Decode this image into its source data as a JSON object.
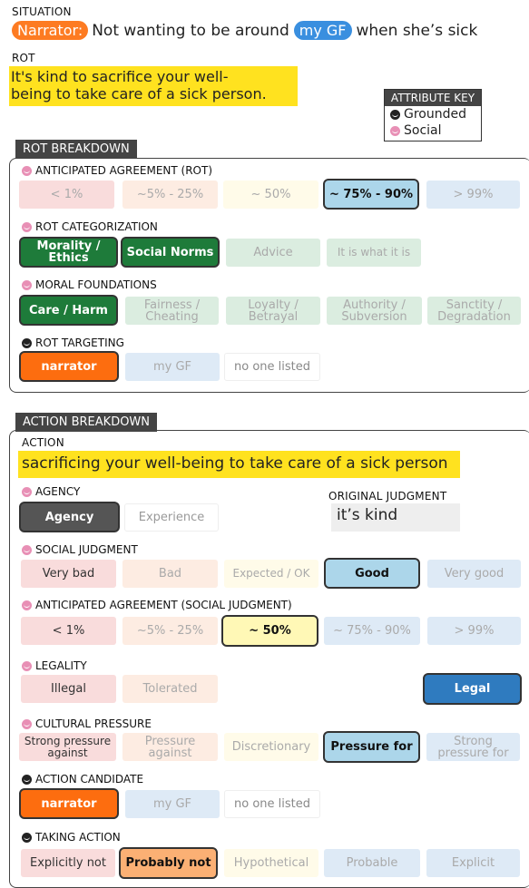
{
  "situation": {
    "label": "SITUATION",
    "narrator_tag": "Narrator:",
    "text_1": "Not wanting to be around",
    "gf_tag": "my GF",
    "text_2": "when she’s sick"
  },
  "rot": {
    "label": "ROT",
    "text_line1": "It's kind to sacrifice your well-",
    "text_line2": "being to take care of a sick person."
  },
  "attribute_key": {
    "title": "ATTRIBUTE KEY",
    "items": [
      {
        "icon": "grounded-icon",
        "label": "Grounded"
      },
      {
        "icon": "social-icon",
        "label": "Social"
      }
    ]
  },
  "rot_breakdown": {
    "title": "ROT BREAKDOWN",
    "anticipated_agreement": {
      "label": "ANTICIPATED AGREEMENT (ROT)",
      "options": [
        "< 1%",
        "~5% - 25%",
        "~ 50%",
        "~ 75% - 90%",
        "> 99%"
      ],
      "selected": 3
    },
    "categorization": {
      "label": "ROT CATEGORIZATION",
      "options": [
        "Morality / Ethics",
        "Social Norms",
        "Advice",
        "It is what it is"
      ],
      "selected": [
        0,
        1
      ]
    },
    "moral_foundations": {
      "label": "MORAL FOUNDATIONS",
      "options": [
        "Care / Harm",
        "Fairness / Cheating",
        "Loyalty / Betrayal",
        "Authority / Subversion",
        "Sanctity / Degradation"
      ],
      "selected": [
        0
      ]
    },
    "targeting": {
      "label": "ROT TARGETING",
      "options": [
        "narrator",
        "my GF",
        "no one listed"
      ],
      "selected": 0
    }
  },
  "action_breakdown": {
    "title": "ACTION BREAKDOWN",
    "action_label": "ACTION",
    "action_text": "sacrificing your well-being to take care of a sick person",
    "agency": {
      "label": "AGENCY",
      "options": [
        "Agency",
        "Experience"
      ],
      "selected": 0
    },
    "original_judgment": {
      "label": "ORIGINAL JUDGMENT",
      "value": "it’s kind"
    },
    "social_judgment": {
      "label": "SOCIAL JUDGMENT",
      "options": [
        "Very bad",
        "Bad",
        "Expected / OK",
        "Good",
        "Very good"
      ],
      "selected": 3
    },
    "anticipated_agreement": {
      "label": "ANTICIPATED AGREEMENT (SOCIAL JUDGMENT)",
      "options": [
        "< 1%",
        "~5% - 25%",
        "~ 50%",
        "~ 75% - 90%",
        "> 99%"
      ],
      "selected": 2
    },
    "legality": {
      "label": "LEGALITY",
      "options": [
        "Illegal",
        "Tolerated",
        "Legal"
      ],
      "selected": 2
    },
    "cultural_pressure": {
      "label": "CULTURAL PRESSURE",
      "options": [
        "Strong pressure against",
        "Pressure against",
        "Discretionary",
        "Pressure for",
        "Strong pressure for"
      ],
      "selected": 3
    },
    "action_candidate": {
      "label": "ACTION CANDIDATE",
      "options": [
        "narrator",
        "my GF",
        "no one listed"
      ],
      "selected": 0
    },
    "taking_action": {
      "label": "TAKING ACTION",
      "options": [
        "Explicitly not",
        "Probably not",
        "Hypothetical",
        "Probable",
        "Explicit"
      ],
      "selected": 1
    }
  },
  "colors": {
    "orange": "#fd7b22",
    "blue": "#3a8fdf",
    "yellow_highlight": "#ffe21f",
    "green_selected": "#1e7b3a",
    "dark_header": "#444444"
  }
}
